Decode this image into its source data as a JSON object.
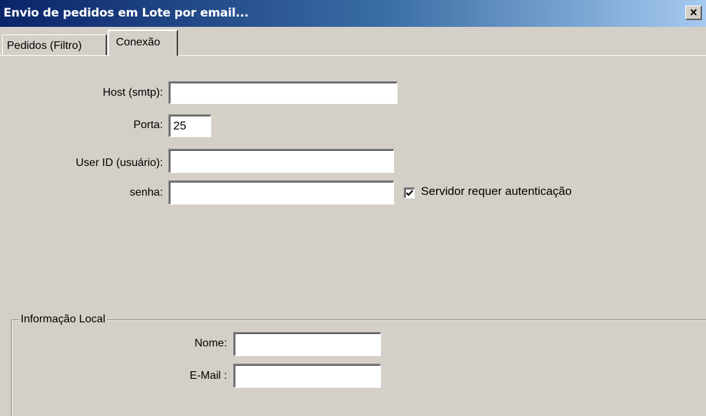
{
  "window": {
    "title": "Envio de pedidos em Lote por email...",
    "close_label": "×"
  },
  "tabs": [
    {
      "label": "Pedidos (Filtro)",
      "active": false
    },
    {
      "label": "Conexão",
      "active": true
    }
  ],
  "connection": {
    "host_label": "Host (smtp):",
    "host_value": "",
    "port_label": "Porta:",
    "port_value": "25",
    "user_label": "User ID (usuário):",
    "user_value": "",
    "password_label": "senha:",
    "password_value": "",
    "auth_checkbox_label": "Servidor requer autenticação",
    "auth_checked": true
  },
  "local_info": {
    "group_title": "Informação Local",
    "name_label": "Nome:",
    "name_value": "",
    "email_label": "E-Mail :",
    "email_value": ""
  }
}
